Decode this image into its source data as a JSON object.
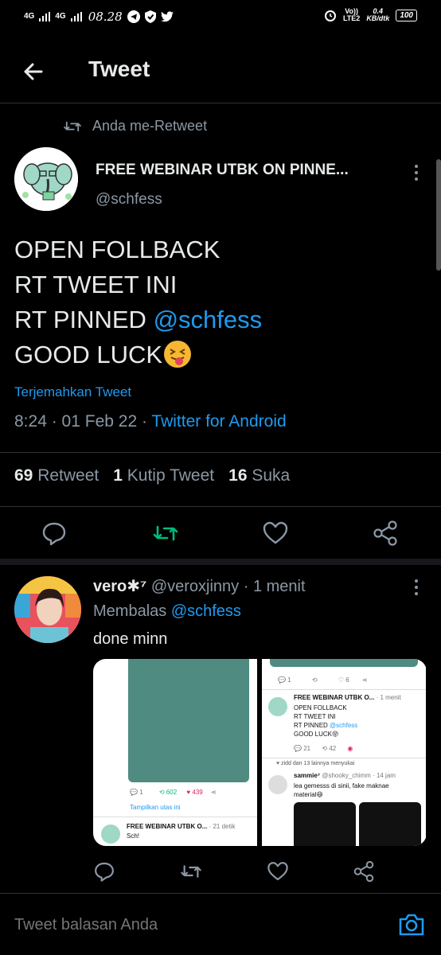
{
  "status_bar": {
    "net1": "4G",
    "net2": "4G",
    "time": "08.28",
    "volte": "Vo))",
    "lte": "LTE2",
    "speed_value": "0.4",
    "speed_unit": "KB/dtk",
    "battery": "100"
  },
  "header": {
    "title": "Tweet"
  },
  "retweet_context": {
    "label": "Anda me-Retweet"
  },
  "tweet": {
    "author_name": "FREE WEBINAR UTBK ON PINNE...",
    "author_handle": "@schfess",
    "lines": [
      "OPEN FOLLBACK",
      "RT TWEET INI",
      "RT PINNED ",
      "GOOD LUCK"
    ],
    "mention": "@schfess",
    "translate_label": "Terjemahkan Tweet",
    "time": "8:24",
    "date": "01 Feb 22",
    "client": "Twitter for Android",
    "retweets": "69",
    "retweets_label": "Retweet",
    "quotes": "1",
    "quotes_label": "Kutip Tweet",
    "likes": "16",
    "likes_label": "Suka"
  },
  "reply": {
    "name": "vero✱⁷",
    "handle": "@veroxjinny",
    "time": "1 menit",
    "replying_prefix": "Membalas ",
    "replying_to": "@schfess",
    "text": "done minn",
    "media": {
      "left": {
        "reply_count": "1",
        "retweet_count": "602",
        "like_count": "439",
        "thread_link": "Tampilkan utas ini",
        "quoted_name": "FREE WEBINAR UTBK O...",
        "quoted_time": "21 detik",
        "quoted_text": "Sch!"
      },
      "right": {
        "reply_count": "1",
        "like_count": "6",
        "name": "FREE WEBINAR UTBK O...",
        "time": "1 menit",
        "lines": [
          "OPEN FOLLBACK",
          "RT TWEET INI",
          "RT PINNED ",
          "GOOD LUCK"
        ],
        "mention": "@schfess",
        "reply_count2": "21",
        "retweet_count2": "42",
        "liked_by": "zidd dan 13 lainnya menyukai",
        "commenter": "sammie⁷",
        "commenter_handle": "@shooky_chimm",
        "commenter_time": "14 jam",
        "comment_lines": [
          "lea gemesss di sinii, fake maknae",
          "material"
        ]
      }
    }
  },
  "compose": {
    "placeholder": "Tweet balasan Anda"
  },
  "colors": {
    "accent": "#1d9bf0",
    "retweet_active": "#00ba7c",
    "muted": "#8b98a5"
  }
}
